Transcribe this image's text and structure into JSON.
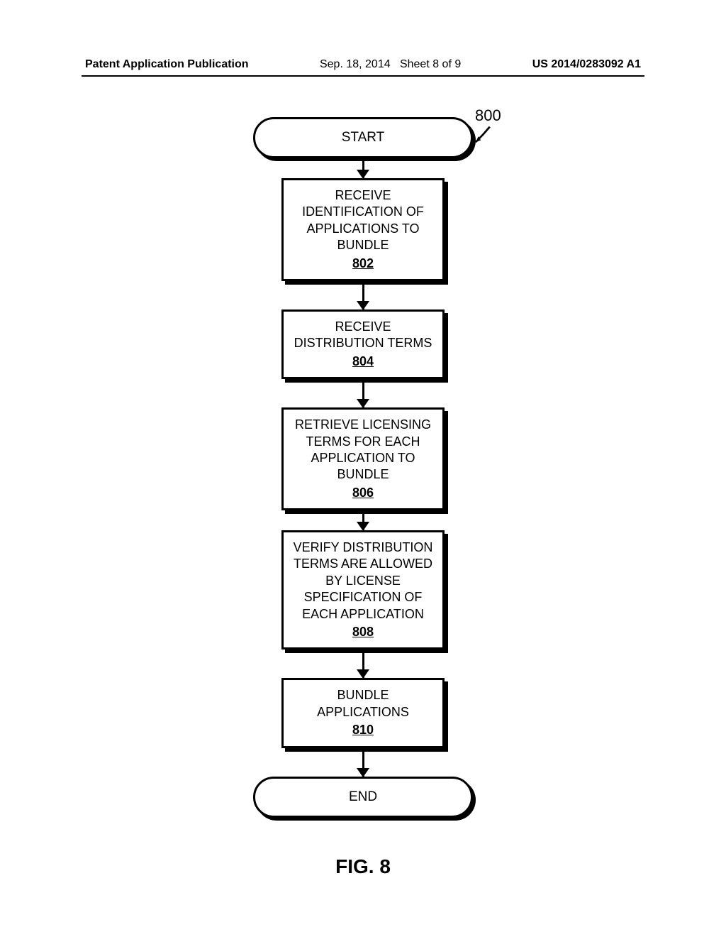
{
  "header": {
    "left": "Patent Application Publication",
    "date": "Sep. 18, 2014",
    "sheet": "Sheet 8 of 9",
    "pubno": "US 2014/0283092 A1"
  },
  "flowchart": {
    "ref_number": "800",
    "start": "START",
    "end": "END",
    "steps": [
      {
        "text": "RECEIVE IDENTIFICATION OF APPLICATIONS TO BUNDLE",
        "ref": "802"
      },
      {
        "text": "RECEIVE DISTRIBUTION TERMS",
        "ref": "804"
      },
      {
        "text": "RETRIEVE LICENSING TERMS FOR EACH APPLICATION TO BUNDLE",
        "ref": "806"
      },
      {
        "text": "VERIFY DISTRIBUTION TERMS ARE ALLOWED BY LICENSE SPECIFICATION OF EACH APPLICATION",
        "ref": "808"
      },
      {
        "text": "BUNDLE APPLICATIONS",
        "ref": "810"
      }
    ]
  },
  "figure_label": "FIG. 8"
}
